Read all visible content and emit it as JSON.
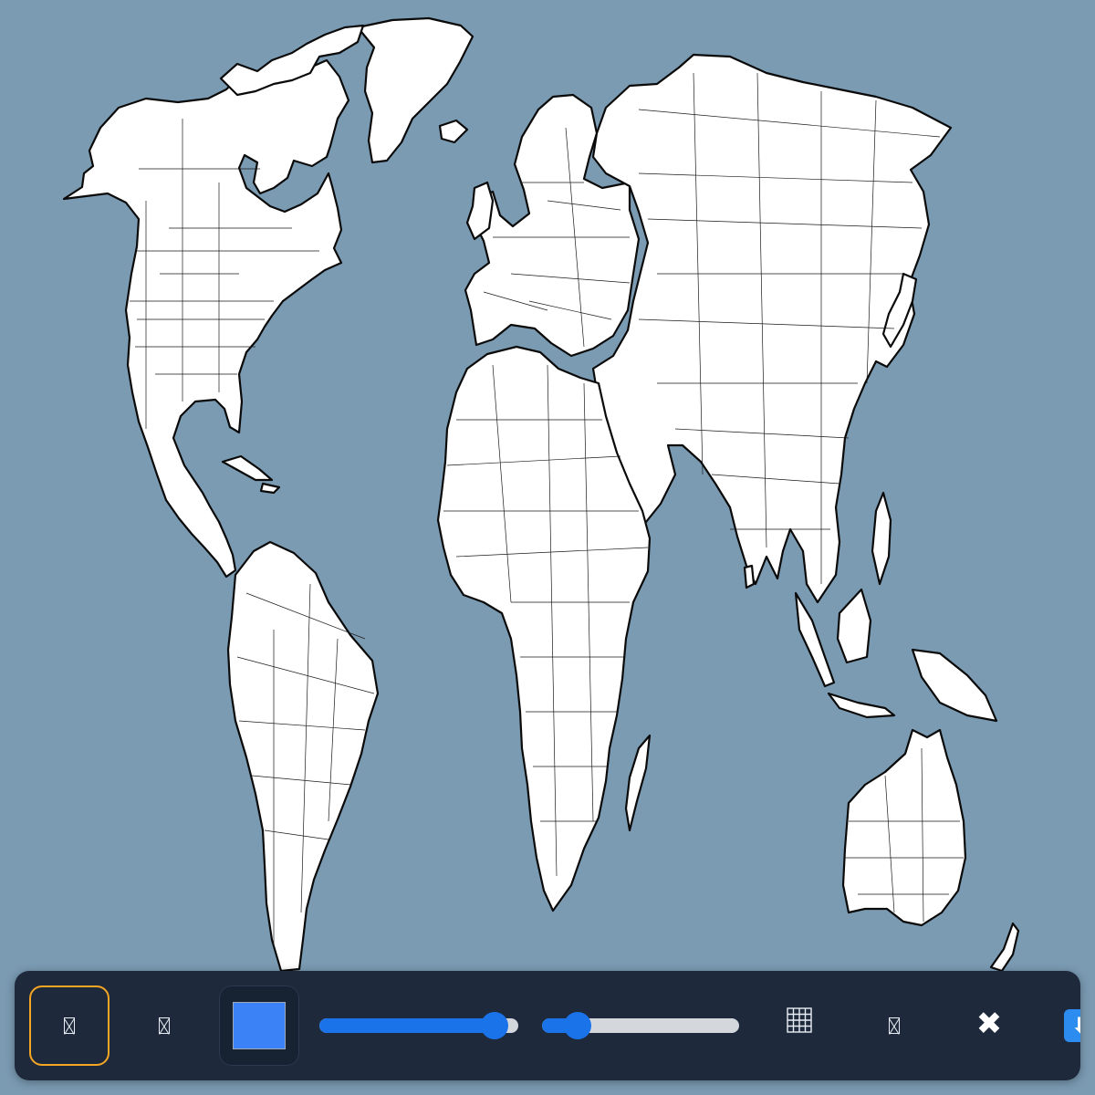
{
  "map": {
    "ocean_color": "#7b9bb3",
    "land_color": "#ffffff",
    "border_color": "#1a1a1a"
  },
  "toolbar": {
    "background": "#1e2a3b",
    "tools": [
      {
        "icon": "unknown-glyph-icon",
        "active": true
      },
      {
        "icon": "unknown-glyph-icon",
        "active": false
      }
    ],
    "fill_color": "#3b82f6",
    "brush_size_percent": 88,
    "opacity_percent": 18,
    "grid_icon": "grid-icon",
    "extra_tool_icon": "unknown-glyph-icon",
    "clear_icon": "close-icon",
    "clear_glyph": "✖",
    "download_icon": "download-icon",
    "download_glyph": "⬇",
    "active_outline": "#f5a623",
    "accent": "#1a73e8"
  }
}
